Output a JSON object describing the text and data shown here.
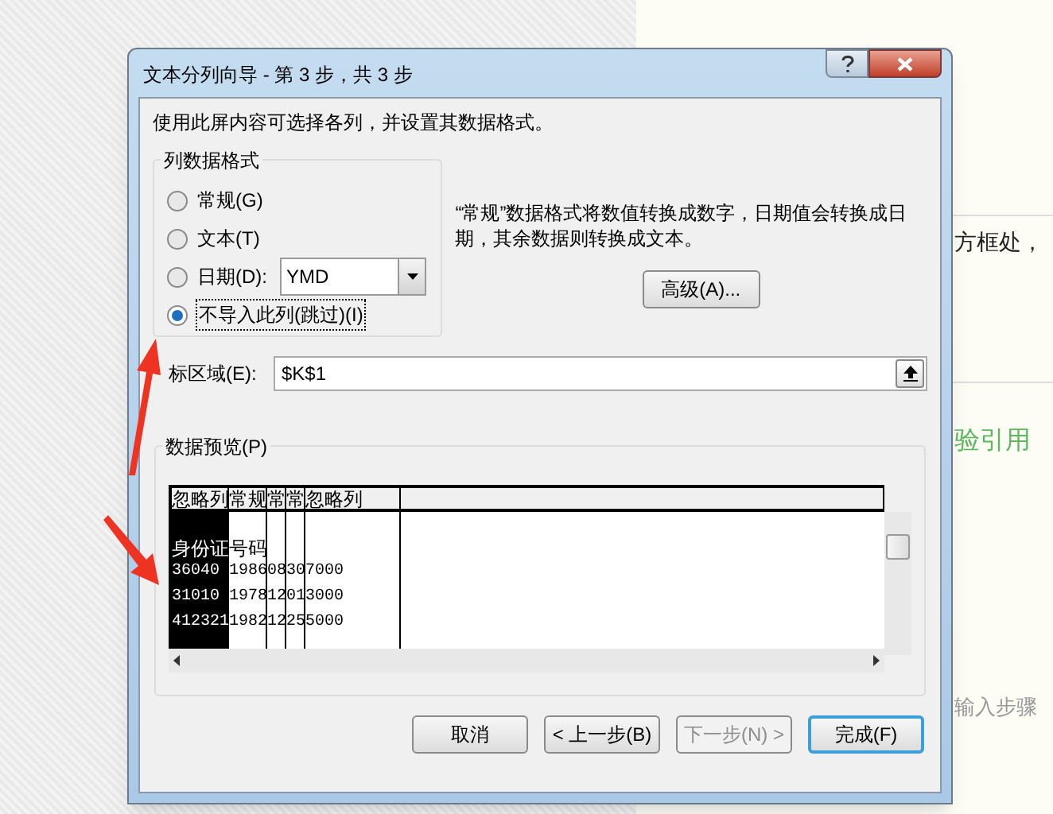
{
  "dialog": {
    "title": "文本分列向导 - 第 3 步，共 3 步",
    "instruction": "使用此屏内容可选择各列，并设置其数据格式。",
    "format_group": {
      "label": "列数据格式",
      "options": [
        {
          "label": "常规(G)",
          "selected": false,
          "kind": "plain"
        },
        {
          "label": "文本(T)",
          "selected": false,
          "kind": "plain"
        },
        {
          "label": "日期(D):",
          "selected": false,
          "kind": "date"
        },
        {
          "label": "不导入此列(跳过)(I)",
          "selected": true,
          "kind": "plain"
        }
      ]
    },
    "date_select": {
      "value": "YMD"
    },
    "description": "“常规”数据格式将数值转换成数字，日期值会转换成日期，其余数据则转换成文本。",
    "advanced_button": "高级(A)...",
    "target": {
      "label": "标区域(E):",
      "value": "$K$1"
    },
    "preview": {
      "label": "数据预览(P)",
      "columns": [
        {
          "header": "忽略列",
          "selected": true
        },
        {
          "header": "常规",
          "selected": false
        },
        {
          "header": "常",
          "selected": false
        },
        {
          "header": "常",
          "selected": false
        },
        {
          "header": "忽略列",
          "selected": false
        }
      ],
      "rows": [
        [
          "身份证",
          "号码"
        ],
        [
          "36040",
          "1986",
          "08",
          "30",
          "7000"
        ],
        [
          "31010",
          "1978",
          "12",
          "01",
          "3000"
        ],
        [
          "412321",
          "1982",
          "12",
          "25",
          "5000"
        ]
      ]
    },
    "buttons": [
      {
        "label": "取消",
        "disabled": false,
        "default": false
      },
      {
        "label": "< 上一步(B)",
        "disabled": false,
        "default": false
      },
      {
        "label": "下一步(N) >",
        "disabled": true,
        "default": false
      },
      {
        "label": "完成(F)",
        "disabled": false,
        "default": true
      }
    ]
  },
  "page_texts": [
    {
      "text": "方框处，",
      "color": "#222222"
    },
    {
      "text": "验引用",
      "color": "#5cb85c"
    },
    {
      "text": "输入步骤",
      "color": "#999999"
    }
  ]
}
